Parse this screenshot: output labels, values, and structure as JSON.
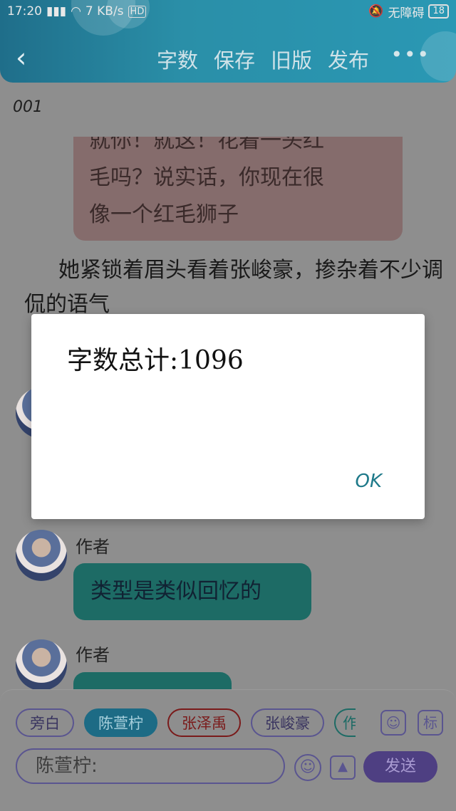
{
  "status_bar": {
    "time": "17:20",
    "network_speed": "7 KB/s",
    "hd_label": "HD",
    "accessibility": "无障碍",
    "battery": "18"
  },
  "toolbar": {
    "back_icon": "back-chevron-icon",
    "word_count_label": "字数",
    "save_label": "保存",
    "old_version_label": "旧版",
    "publish_label": "发布",
    "more_icon": "more-dots-icon",
    "accent_color": "#2a98b4"
  },
  "chapter": {
    "title": "001"
  },
  "messages": [
    {
      "type": "bubble",
      "lines": [
        "就你！就这！花着一头红",
        "毛吗？说实话，你现在很",
        "像一个红毛狮子"
      ]
    },
    {
      "type": "narration",
      "text": "她紧锁着眉头看着张峻豪，掺杂着不少调侃的语气"
    },
    {
      "type": "author_bubble",
      "author": "作者",
      "text": "类型是类似回忆的"
    },
    {
      "type": "author_bubble",
      "author": "作者",
      "text": ""
    }
  ],
  "composer": {
    "chips": [
      {
        "label": "旁白",
        "active": false
      },
      {
        "label": "陈萱柠",
        "active": true
      },
      {
        "label": "张泽禹",
        "active": false
      },
      {
        "label": "张峻豪",
        "active": false
      },
      {
        "label": "作",
        "active": false
      }
    ],
    "person_icon": "person-icon",
    "label_button": "标",
    "input_value": "陈萱柠:",
    "emoji_icon": "emoji-icon",
    "image_icon": "image-icon",
    "send_label": "发送"
  },
  "dialog": {
    "message": "字数总计:1096",
    "ok_label": "OK"
  }
}
